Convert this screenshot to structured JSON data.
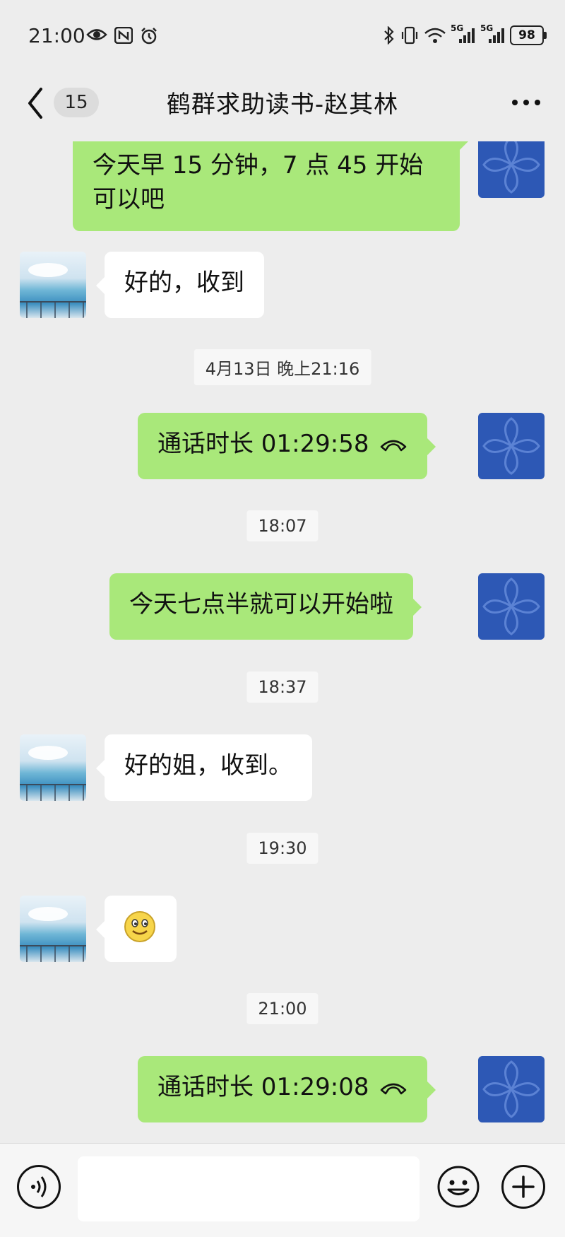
{
  "status_bar": {
    "time": "21:00",
    "battery": "98",
    "network_1": "5G",
    "network_2": "5G"
  },
  "nav": {
    "unread_count": "15",
    "title": "鹤群求助读书-赵其林"
  },
  "messages": [
    {
      "type": "text",
      "side": "me",
      "text_line1": "今天早 15 分钟，7 点 45 开始",
      "text_line2": "可以吧"
    },
    {
      "type": "text",
      "side": "other",
      "text": "好的，收到"
    },
    {
      "type": "time",
      "text": "4月13日 晚上21:16"
    },
    {
      "type": "call",
      "side": "me",
      "text": "通话时长 01:29:58"
    },
    {
      "type": "time",
      "text": "18:07"
    },
    {
      "type": "text",
      "side": "me",
      "text": "今天七点半就可以开始啦"
    },
    {
      "type": "time",
      "text": "18:37"
    },
    {
      "type": "text",
      "side": "other",
      "text": "好的姐，收到。"
    },
    {
      "type": "time",
      "text": "19:30"
    },
    {
      "type": "emoji",
      "side": "other",
      "emoji": "🙂"
    },
    {
      "type": "time",
      "text": "21:00"
    },
    {
      "type": "call",
      "side": "me",
      "text": "通话时长 01:29:08"
    }
  ],
  "input": {
    "placeholder": ""
  },
  "colors": {
    "background": "#ededed",
    "my_bubble": "#a9e87a",
    "other_bubble": "#ffffff",
    "my_avatar": "#2d58b5"
  }
}
